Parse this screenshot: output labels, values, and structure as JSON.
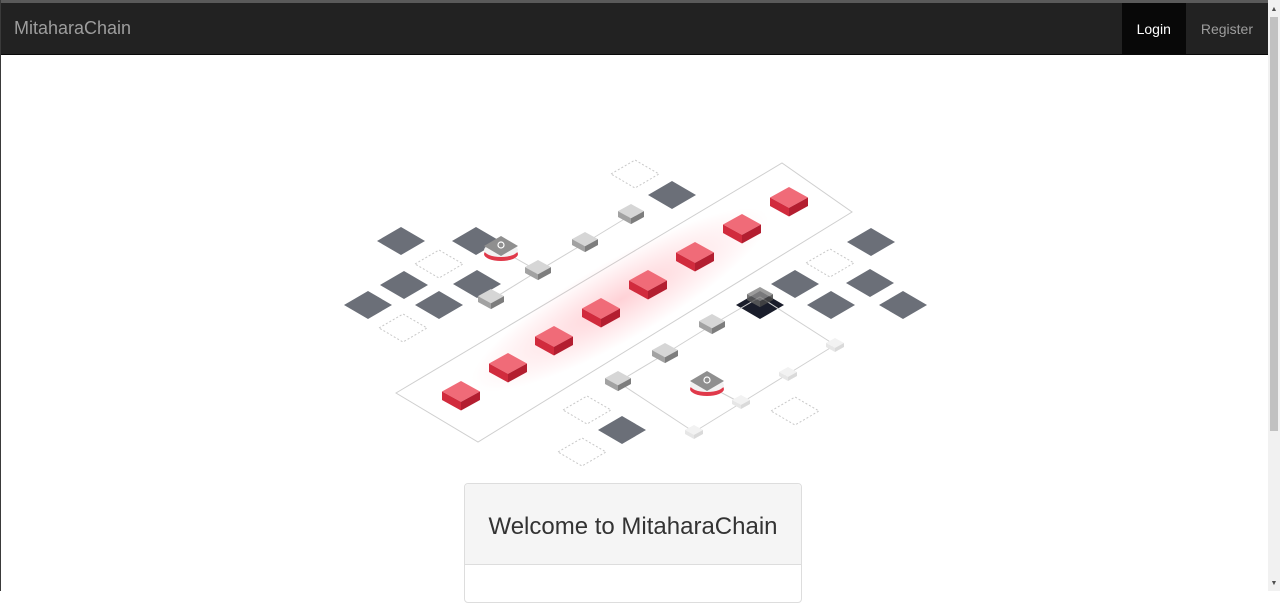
{
  "navbar": {
    "brand": "MitaharaChain",
    "links": [
      {
        "label": "Login",
        "active": true
      },
      {
        "label": "Register",
        "active": false
      }
    ]
  },
  "hero": {
    "illustration": "blockchain-isometric-illustration",
    "colors": {
      "accent_block": "#e0394a",
      "grey_block": "#9a9a9a",
      "tile": "#6b6f78",
      "dark_block": "#1a1d2b"
    }
  },
  "welcome": {
    "title": "Welcome to MitaharaChain"
  }
}
